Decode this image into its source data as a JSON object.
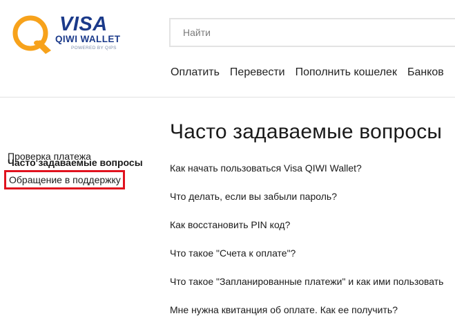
{
  "header": {
    "logo": {
      "visa_text": "VISA",
      "qiwi_text": "QIWI WALLET",
      "powered_text": "POWERED BY QIPS",
      "brand_blue": "#1b3a8a",
      "brand_orange": "#f7a21b"
    },
    "search": {
      "placeholder": "Найти",
      "value": ""
    },
    "nav": [
      {
        "label": "Оплатить"
      },
      {
        "label": "Перевести"
      },
      {
        "label": "Пополнить кошелек"
      },
      {
        "label": "Банков"
      }
    ]
  },
  "sidebar": {
    "items": [
      {
        "label": "Часто задаваемые вопросы",
        "active": true
      },
      {
        "label": "Проверка платежа",
        "active": false
      },
      {
        "label": "Обращение в поддержку",
        "highlighted": true,
        "highlight_color": "#e0121e"
      }
    ]
  },
  "main": {
    "title": "Часто задаваемые вопросы",
    "faq": [
      {
        "question": "Как начать пользоваться Visa QIWI Wallet?"
      },
      {
        "question": "Что делать, если вы забыли пароль?"
      },
      {
        "question": "Как восстановить PIN код?"
      },
      {
        "question": "Что такое \"Счета к оплате\"?"
      },
      {
        "question": "Что такое \"Запланированные платежи\" и как ими пользовать"
      },
      {
        "question": "Мне нужна квитанция об оплате. Как ее получить?"
      }
    ]
  }
}
